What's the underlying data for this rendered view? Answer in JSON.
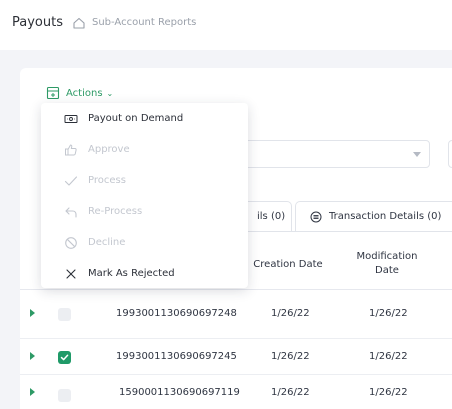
{
  "header": {
    "title": "Payouts",
    "breadcrumb": "Sub-Account Reports"
  },
  "toolbar": {
    "actions_label": "Actions"
  },
  "actions_menu": {
    "items": [
      {
        "label": "Payout on Demand",
        "icon": "cash-icon",
        "enabled": true
      },
      {
        "label": "Approve",
        "icon": "thumbs-up-icon",
        "enabled": false
      },
      {
        "label": "Process",
        "icon": "checkmark-icon",
        "enabled": false
      },
      {
        "label": "Re-Process",
        "icon": "undo-arrow-icon",
        "enabled": false
      },
      {
        "label": "Decline",
        "icon": "block-icon",
        "enabled": false
      },
      {
        "label": "Mark As Rejected",
        "icon": "x-icon",
        "enabled": true
      }
    ]
  },
  "tabs": [
    {
      "label": "ils (0)"
    },
    {
      "label": "Transaction Details (0)"
    }
  ],
  "table": {
    "columns": {
      "creation_date": "Creation Date",
      "modification_date": "Modification Date"
    },
    "rows": [
      {
        "id": "1993001130690697248",
        "creation_date": "1/26/22",
        "modification_date": "1/26/22",
        "checked": false
      },
      {
        "id": "1993001130690697245",
        "creation_date": "1/26/22",
        "modification_date": "1/26/22",
        "checked": true
      },
      {
        "id": "1590001130690697119",
        "creation_date": "1/26/22",
        "modification_date": "1/26/22",
        "checked": false
      }
    ]
  },
  "colors": {
    "accent": "#2e9a66",
    "checkbox_checked": "#1f9a68",
    "disabled_text": "#c3c7cf",
    "background": "#f3f4f8"
  }
}
